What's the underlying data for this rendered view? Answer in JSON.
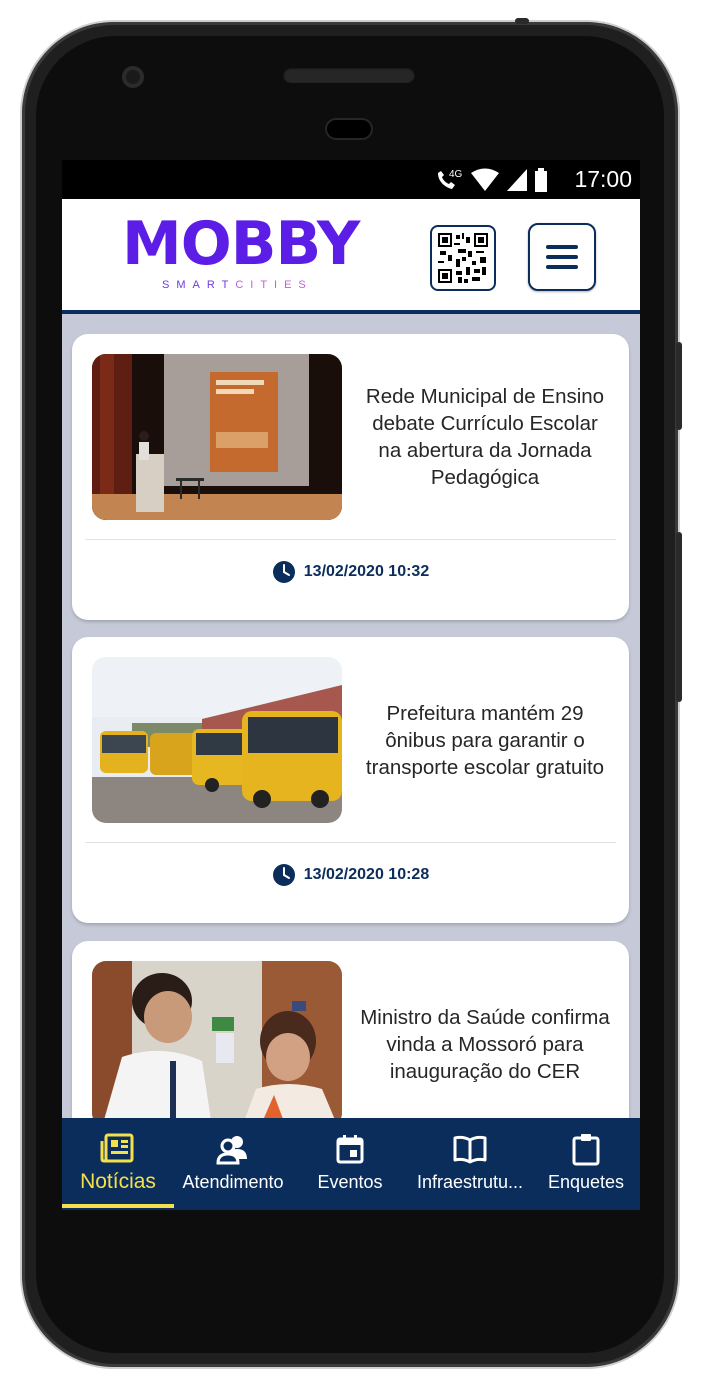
{
  "status_bar": {
    "time": "17:00",
    "network": "4G"
  },
  "header": {
    "logo": "MOBBY",
    "logo_sub_1": "SMART",
    "logo_sub_2": "CITIES"
  },
  "news": [
    {
      "title": "Rede Municipal de Ensino debate Currículo Escolar na abertura da Jornada Pedagógica",
      "date": "13/02/2020 10:32",
      "image": "stage-presentation-photo"
    },
    {
      "title": "Prefeitura mantém 29 ônibus para garantir o transporte escolar gratuito",
      "date": "13/02/2020 10:28",
      "image": "school-buses-photo"
    },
    {
      "title": "Ministro da Saúde confirma vinda a Mossoró para inauguração do CER",
      "date": "",
      "image": "minister-meeting-photo"
    }
  ],
  "bottom_nav": [
    {
      "label": "Notícias",
      "icon": "newspaper-icon",
      "active": true
    },
    {
      "label": "Atendimento",
      "icon": "people-icon",
      "active": false
    },
    {
      "label": "Eventos",
      "icon": "calendar-icon",
      "active": false
    },
    {
      "label": "Infraestrutu...",
      "icon": "book-open-icon",
      "active": false
    },
    {
      "label": "Enquetes",
      "icon": "clipboard-icon",
      "active": false
    }
  ],
  "colors": {
    "brand_purple": "#5c1ee6",
    "navy": "#0b2d5c",
    "active_yellow": "#f4e04d",
    "feed_bg": "#c6c9d8"
  }
}
